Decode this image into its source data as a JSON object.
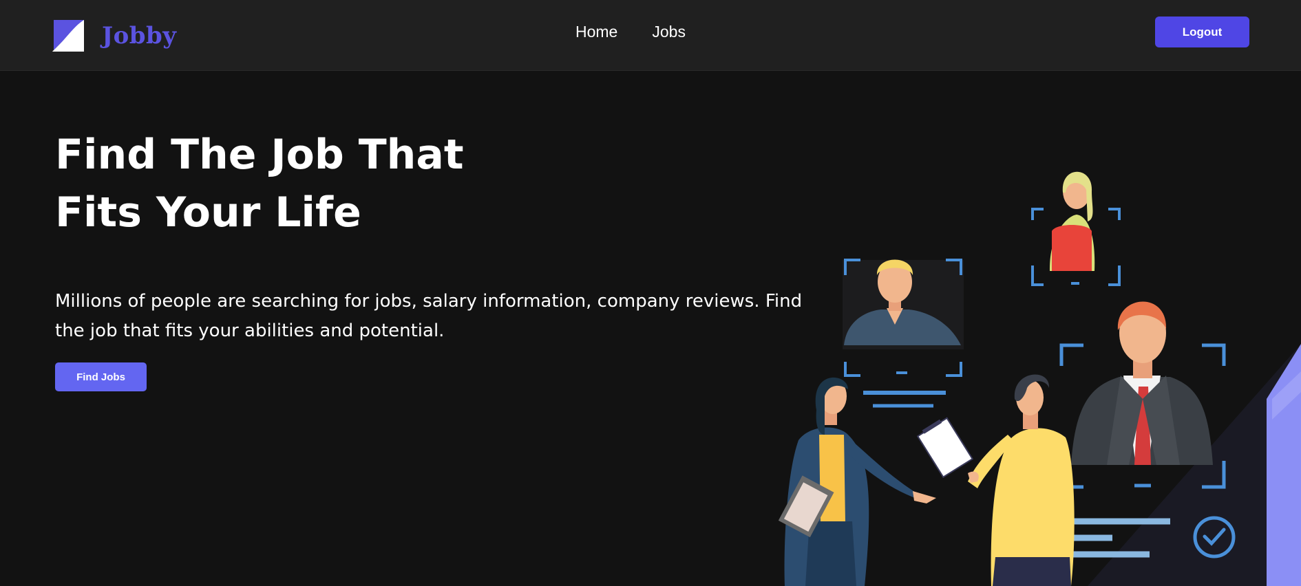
{
  "navbar": {
    "brand_name": "Jobby",
    "links": [
      {
        "label": "Home"
      },
      {
        "label": "Jobs"
      }
    ],
    "logout_label": "Logout"
  },
  "hero": {
    "title_line1": "Find The Job That",
    "title_line2": "Fits Your Life",
    "description": "Millions of people are searching for jobs, salary information, company reviews. Find the job that fits your abilities and potential.",
    "cta_label": "Find Jobs"
  },
  "colors": {
    "background": "#121212",
    "navbar_background": "#202020",
    "brand": "#5b53e0",
    "logout_button": "#4f46e5",
    "cta_button": "#6366f1",
    "frame_accent": "#4a90d9"
  },
  "icons": {
    "logo": "jobby-logo-icon",
    "check": "check-circle-icon"
  }
}
